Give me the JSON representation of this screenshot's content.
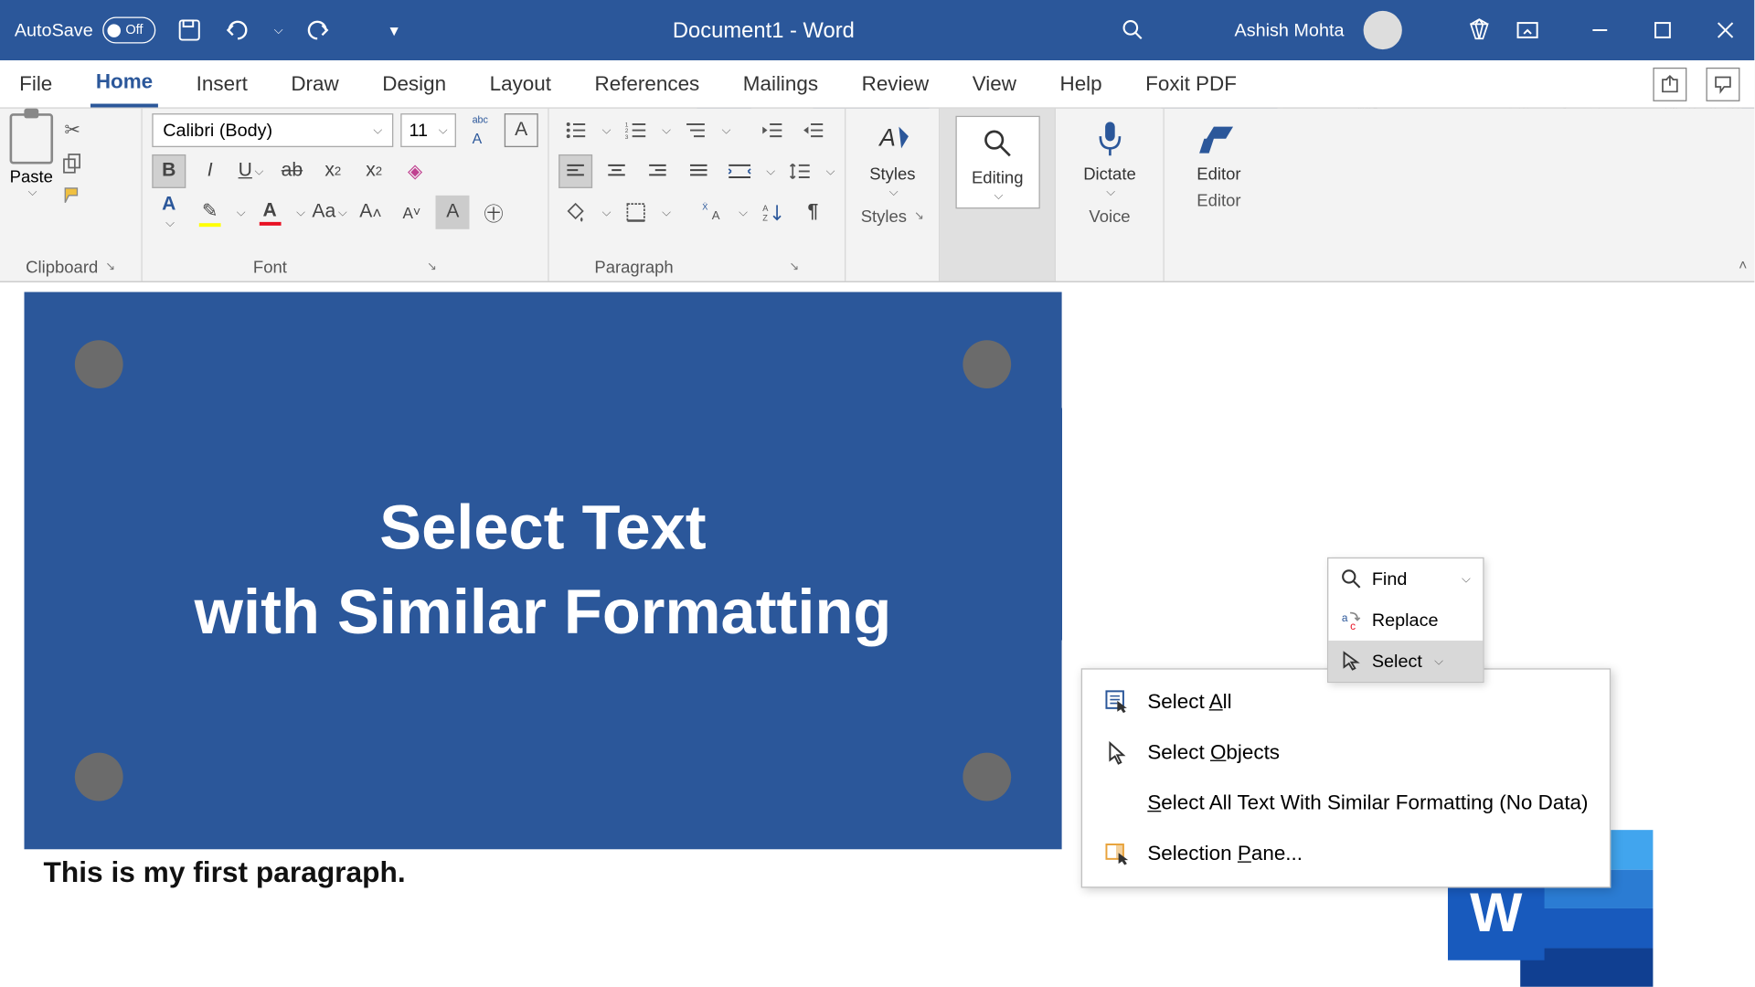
{
  "titlebar": {
    "autosave": "AutoSave",
    "autosave_state": "Off",
    "doc_title": "Document1  -  Word",
    "user": "Ashish Mohta"
  },
  "tabs": [
    "File",
    "Home",
    "Insert",
    "Draw",
    "Design",
    "Layout",
    "References",
    "Mailings",
    "Review",
    "View",
    "Help",
    "Foxit PDF"
  ],
  "active_tab": "Home",
  "ribbon": {
    "clipboard": {
      "label": "Clipboard",
      "paste": "Paste"
    },
    "font": {
      "label": "Font",
      "name": "Calibri (Body)",
      "size": "11"
    },
    "paragraph": {
      "label": "Paragraph"
    },
    "styles": {
      "label": "Styles",
      "btn": "Styles"
    },
    "editing": {
      "label": "Editing",
      "btn": "Editing"
    },
    "voice": {
      "label": "Voice",
      "btn": "Dictate"
    },
    "editor": {
      "label": "Editor",
      "btn": "Editor"
    }
  },
  "editing_menu": {
    "find": "Find",
    "replace": "Replace",
    "select": "Select"
  },
  "select_menu": {
    "select_all_pre": "Select ",
    "select_all_u": "A",
    "select_all_post": "ll",
    "select_objects_pre": "Select ",
    "select_objects_u": "O",
    "select_objects_post": "bjects",
    "similar_u": "S",
    "similar_post": "elect All Text With Similar Formatting (No Data)",
    "pane_pre": "Selection ",
    "pane_u": "P",
    "pane_post": "ane..."
  },
  "document": {
    "blue_text_1": "Select Text",
    "blue_text_2": "with Similar Formatting",
    "para": "This is my first paragraph."
  },
  "word_logo": "W"
}
